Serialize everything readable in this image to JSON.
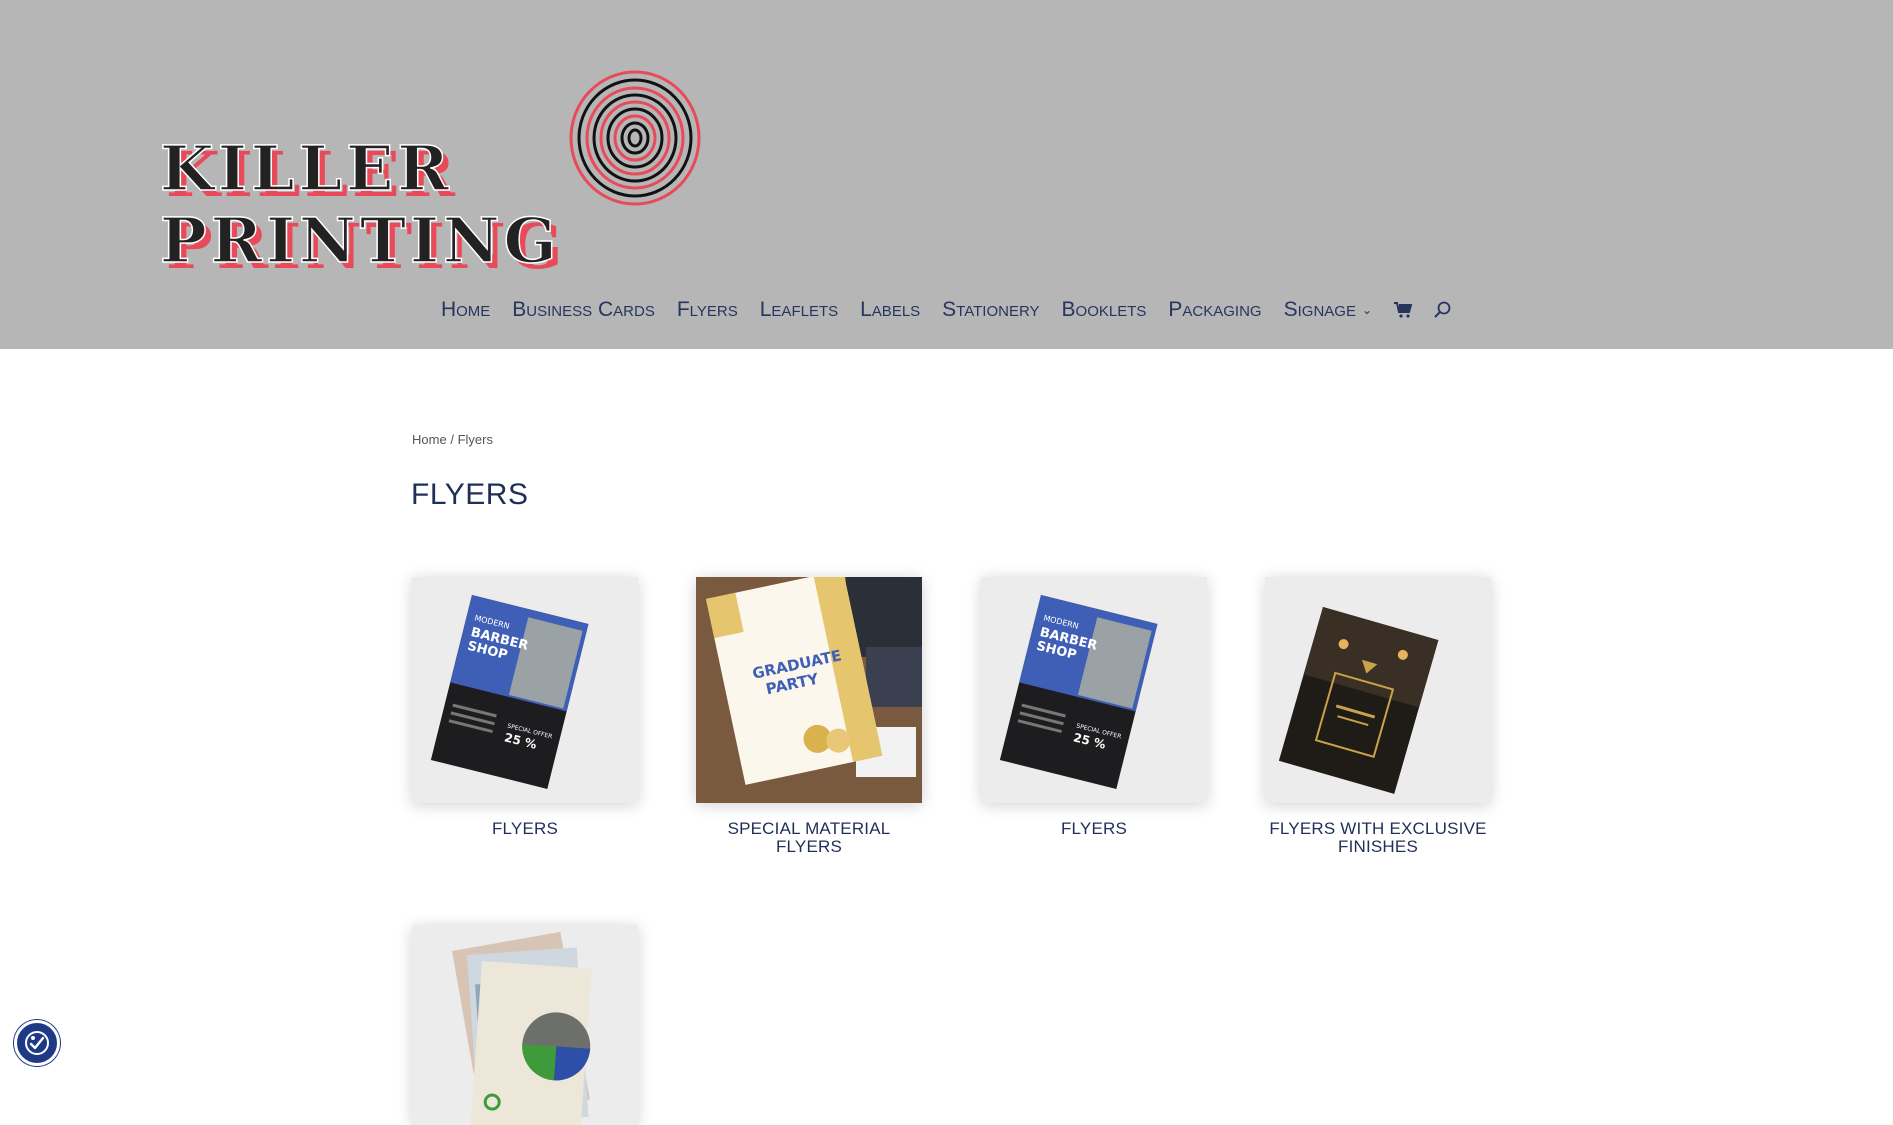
{
  "header": {
    "logo": {
      "line1": "KILLER",
      "line2": "PRINTING"
    },
    "nav": {
      "items": [
        {
          "label": "Home"
        },
        {
          "label": "Business Cards"
        },
        {
          "label": "Flyers"
        },
        {
          "label": "Leaflets"
        },
        {
          "label": "Labels"
        },
        {
          "label": "Stationery"
        },
        {
          "label": "Booklets"
        },
        {
          "label": "Packaging"
        },
        {
          "label": "Signage",
          "has_dropdown": true
        }
      ],
      "icons": [
        "cart-icon",
        "search-icon"
      ]
    }
  },
  "breadcrumb": {
    "home": "Home",
    "separator": "/",
    "current": "Flyers"
  },
  "page": {
    "title": "FLYERS"
  },
  "products": [
    {
      "title": "FLYERS",
      "image": "barber-shop-flyer"
    },
    {
      "title": "SPECIAL MATERIAL FLYERS",
      "image": "graduate-party-flyer"
    },
    {
      "title": "FLYERS",
      "image": "barber-shop-flyer"
    },
    {
      "title": "FLYERS WITH EXCLUSIVE FINISHES",
      "image": "black-gold-flyer"
    },
    {
      "title": "",
      "image": "green-flyers-stack"
    }
  ],
  "flyer_art": {
    "barber": {
      "l1": "MODERN",
      "l2": "BARBER",
      "l3": "SHOP",
      "promo": "SPECIAL OFFER",
      "pct": "25 %"
    },
    "graduate": {
      "l1": "GRADUATE",
      "l2": "PARTY"
    }
  },
  "colors": {
    "header_bg": "#b6b6b6",
    "nav_text": "#27355e",
    "title_text": "#1f2f57",
    "accent_blue": "#3f5fb7",
    "a11y_button": "#1e3a86"
  },
  "accessibility_button": {
    "icon": "accessibility-icon"
  }
}
